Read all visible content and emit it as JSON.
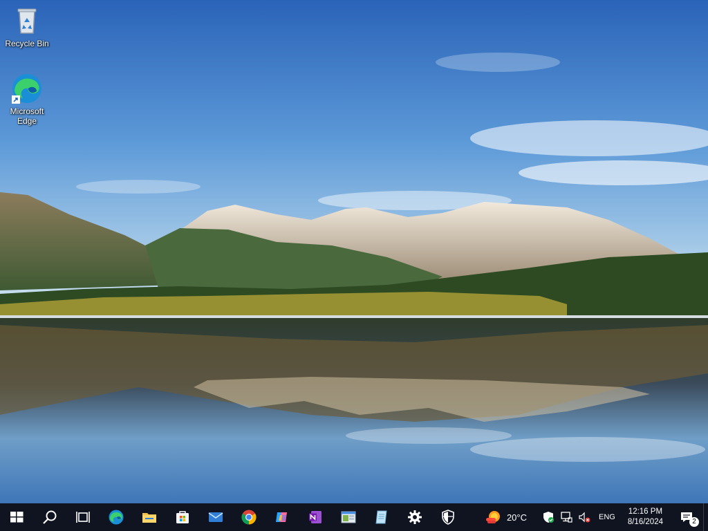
{
  "desktop": {
    "icons": [
      {
        "label": "Recycle Bin",
        "icon": "recycle-bin-icon"
      },
      {
        "label": "Microsoft Edge",
        "icon": "edge-icon"
      }
    ]
  },
  "taskbar": {
    "apps": [
      {
        "icon": "windows-logo-icon"
      },
      {
        "icon": "search-icon"
      },
      {
        "icon": "task-view-icon"
      },
      {
        "icon": "edge-icon"
      },
      {
        "icon": "file-explorer-icon"
      },
      {
        "icon": "microsoft-store-icon"
      },
      {
        "icon": "mail-icon"
      },
      {
        "icon": "chrome-icon"
      },
      {
        "icon": "copilot-icon"
      },
      {
        "icon": "onenote-icon"
      },
      {
        "icon": "app-window-icon"
      },
      {
        "icon": "notepad-icon"
      },
      {
        "icon": "settings-gear-icon"
      },
      {
        "icon": "windows-security-icon"
      }
    ],
    "tray": {
      "weather_temp": "20°C",
      "language": "ENG",
      "time": "12:16 PM",
      "date": "8/16/2024",
      "notification_count": "2"
    }
  },
  "colors": {
    "taskbar_bg": "#0f1420",
    "accent": "#0078d4"
  }
}
